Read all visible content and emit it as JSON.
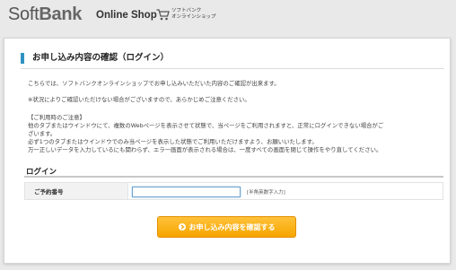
{
  "header": {
    "logo_soft": "Soft",
    "logo_bank": "Bank",
    "shop_title": "Online Shop",
    "shop_sub_line1": "ソフトバンク",
    "shop_sub_line2": "オンラインショップ"
  },
  "main": {
    "title": "お申し込み内容の確認（ログイン）",
    "intro": "こちらでは、ソフトバンクオンラインショップでお申し込みいただいた内容のご確認が出来ます。",
    "notice": "※状況によりご確認いただけない場合がございますので、あらかじめご注意ください。",
    "usage_heading": "【ご利用時のご注意】",
    "usage_lines": [
      "他のタブまたはウインドウにて、複数のWebページを表示させて状態で、当ページをご利用されますと、正常にログインできない場合がご",
      "ざいます。",
      "必ず1つのタブまたはウインドウでのみ当ページを表示した状態でご利用いただけますよう、お願いいたします。",
      "万一正しいデータを入力しているにも関わらず、エラー画面が表示される場合は、一度すべての画面を閉じて操作をやり直してください。"
    ],
    "login_heading": "ログイン",
    "form": {
      "label": "ご予約番号",
      "value": "",
      "hint": "[半角英数字入力]"
    },
    "button_label": "お申し込み内容を確認する"
  },
  "colors": {
    "accent_bar": "#2e93c2",
    "button": "#f6a500"
  }
}
